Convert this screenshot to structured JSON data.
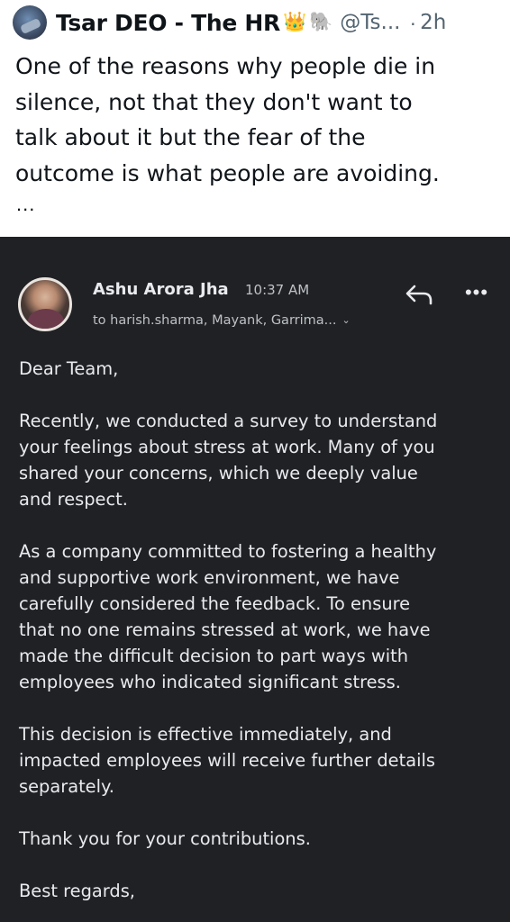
{
  "tweet": {
    "author_name": "Tsar DEO - The HR",
    "emoji_crown": "👑",
    "emoji_elephant": "🐘",
    "handle": "@Ts...",
    "separator": "·",
    "time": "2h",
    "text": "One of the reasons why people die in\nsilence, not that they don't want to\ntalk about it but the fear of the\noutcome is what people are avoiding.",
    "more": "..."
  },
  "email": {
    "sender_name": "Ashu Arora Jha",
    "time": "10:37 AM",
    "recipients": "to harish.sharma, Mayank, Garrima...",
    "body": [
      "Dear Team,",
      "Recently, we conducted a survey to understand\nyour feelings about stress at work. Many of you\nshared your concerns, which we deeply value\nand respect.",
      "As a company committed to fostering a healthy\nand supportive work environment, we have\ncarefully considered the feedback. To ensure\nthat no one remains stressed at work, we have\nmade the difficult decision to part ways with\nemployees who indicated significant stress.",
      "This decision is effective immediately, and\nimpacted employees will receive further details\nseparately.",
      "Thank you for your contributions.",
      "Best regards,"
    ],
    "icons": {
      "reply": "reply-icon",
      "more": "more-options-icon",
      "expand": "chevron-down-icon"
    }
  },
  "colors": {
    "tweet_text": "#0f1419",
    "tweet_secondary": "#536471",
    "email_background": "#202124",
    "email_text": "#e8eaed"
  }
}
